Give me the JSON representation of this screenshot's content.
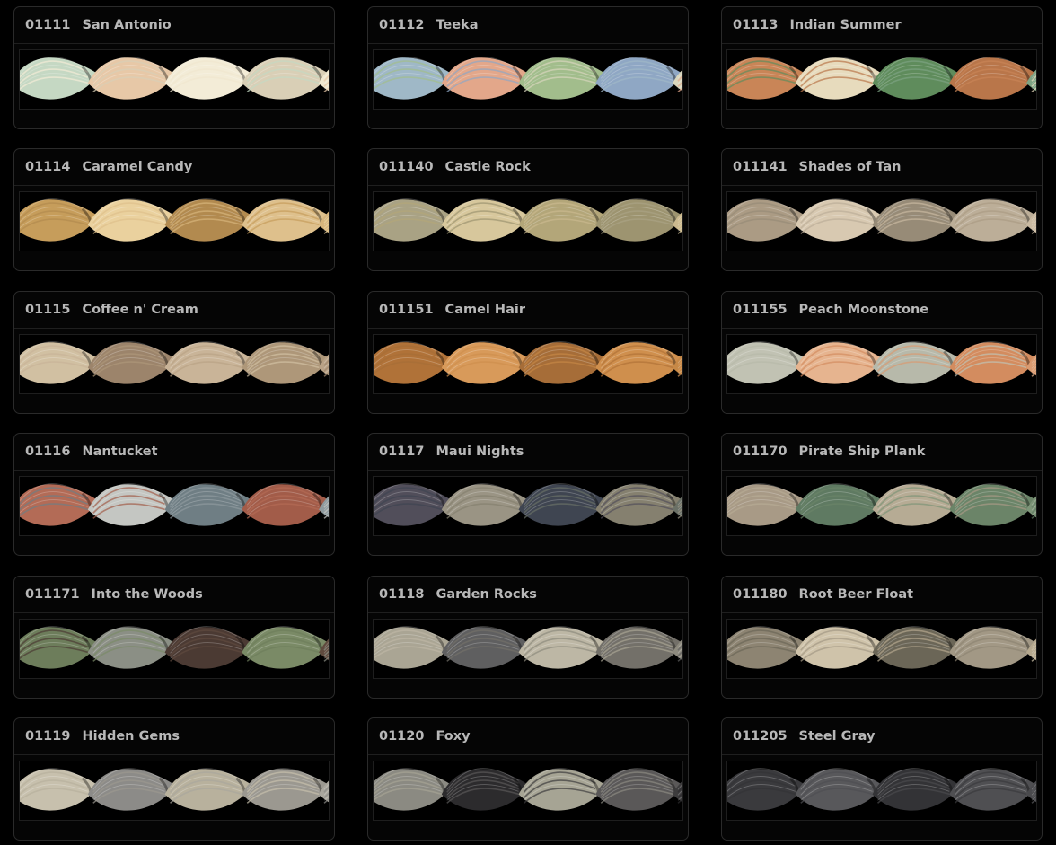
{
  "threads": [
    {
      "code": "01111",
      "name": "San Antonio",
      "colors": [
        "#efe7cf",
        "#c5d8c3",
        "#e7c8a7",
        "#f3ecd7",
        "#d9cfb6"
      ]
    },
    {
      "code": "01112",
      "name": "Teeka",
      "colors": [
        "#d9d6bd",
        "#9fb8c7",
        "#e3a78a",
        "#a2bd8c",
        "#8fa7c4"
      ]
    },
    {
      "code": "01113",
      "name": "Indian Summer",
      "colors": [
        "#7ea383",
        "#c98557",
        "#e7dbbd",
        "#5f8c5c",
        "#b9764a"
      ]
    },
    {
      "code": "01114",
      "name": "Caramel Candy",
      "colors": [
        "#d7b57c",
        "#c69d5b",
        "#ead19e",
        "#b28a4f",
        "#dec08c"
      ]
    },
    {
      "code": "011140",
      "name": "Castle Rock",
      "colors": [
        "#cbb98e",
        "#a9a284",
        "#d7c79c",
        "#b3a679",
        "#9d9470"
      ]
    },
    {
      "code": "011141",
      "name": "Shades of Tan",
      "colors": [
        "#c9b9a1",
        "#ab9b84",
        "#d8c9b1",
        "#978b77",
        "#bcae98"
      ]
    },
    {
      "code": "01115",
      "name": "Coffee n' Cream",
      "colors": [
        "#b9a286",
        "#d1c0a2",
        "#9c846b",
        "#c9b498",
        "#ae9779"
      ]
    },
    {
      "code": "011151",
      "name": "Camel Hair",
      "colors": [
        "#c68846",
        "#b07238",
        "#d89a5a",
        "#a66d38",
        "#cf8f4d"
      ]
    },
    {
      "code": "011155",
      "name": "Peach Moonstone",
      "colors": [
        "#d99a70",
        "#c1c2b3",
        "#e6b48f",
        "#b7b9aa",
        "#d38c5f"
      ]
    },
    {
      "code": "01116",
      "name": "Nantucket",
      "colors": [
        "#8e9a9e",
        "#b36b56",
        "#c4c6c2",
        "#6f7e84",
        "#a25c49"
      ]
    },
    {
      "code": "01117",
      "name": "Maui Nights",
      "colors": [
        "#6a7066",
        "#514e5a",
        "#9a9484",
        "#3f4551",
        "#85806f"
      ]
    },
    {
      "code": "011170",
      "name": "Pirate Ship Plank",
      "colors": [
        "#7d9478",
        "#a89a86",
        "#5f7a62",
        "#b6ab94",
        "#6b8468"
      ]
    },
    {
      "code": "011171",
      "name": "Into the Woods",
      "colors": [
        "#5f4a3e",
        "#6d7d5b",
        "#8b8f85",
        "#4b3a33",
        "#7a8a66"
      ]
    },
    {
      "code": "01118",
      "name": "Garden Rocks",
      "colors": [
        "#8d8a7e",
        "#aaa594",
        "#5f5f60",
        "#bdb7a5",
        "#737069"
      ]
    },
    {
      "code": "011180",
      "name": "Root Beer Float",
      "colors": [
        "#b5a88e",
        "#8d8472",
        "#cfc3aa",
        "#6b6657",
        "#a29885"
      ]
    },
    {
      "code": "01119",
      "name": "Hidden Gems",
      "colors": [
        "#a9a69d",
        "#c7c0ad",
        "#8c8b88",
        "#b8b19d",
        "#9b9890"
      ]
    },
    {
      "code": "01120",
      "name": "Foxy",
      "colors": [
        "#3d3c3d",
        "#8b8a82",
        "#2c2b2d",
        "#a6a494",
        "#5a5858"
      ]
    },
    {
      "code": "011205",
      "name": "Steel Gray",
      "colors": [
        "#4a4a4d",
        "#3a3a3d",
        "#58585b",
        "#333336",
        "#4f4f52"
      ]
    }
  ]
}
